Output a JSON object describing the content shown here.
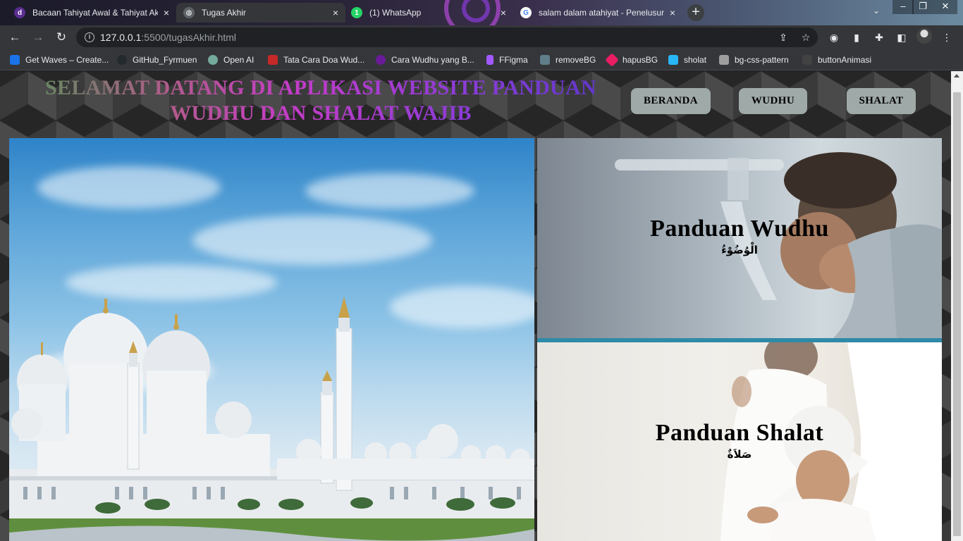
{
  "browser": {
    "tabs": [
      {
        "title": "Bacaan Tahiyat Awal & Tahiyat Ak",
        "icon": "d-site-icon",
        "active": false
      },
      {
        "title": "Tugas Akhir",
        "icon": "globe-icon",
        "active": true
      },
      {
        "title": "(1) WhatsApp",
        "icon": "whatsapp-icon",
        "active": false
      },
      {
        "title": "salam dalam atahiyat - Penelusur",
        "icon": "google-icon",
        "active": false
      }
    ],
    "close_symbol": "×",
    "new_tab_symbol": "+",
    "url_host": "127.0.0.1",
    "url_path": ":5500/tugasAkhir.html",
    "bookmarks": [
      {
        "label": "Get Waves – Create...",
        "color": "#1a73e8"
      },
      {
        "label": "GitHub_Fyrmuen",
        "color": "#24292e"
      },
      {
        "label": "Open AI",
        "color": "#74aa9c"
      },
      {
        "label": "Tata Cara Doa Wud...",
        "color": "#c62828"
      },
      {
        "label": "Cara Wudhu yang B...",
        "color": "#6a1b9a"
      },
      {
        "label": "FFigma",
        "color": "#a259ff"
      },
      {
        "label": "removeBG",
        "color": "#607d8b"
      },
      {
        "label": "hapusBG",
        "color": "#e91e63"
      },
      {
        "label": "sholat",
        "color": "#29b6f6"
      },
      {
        "label": "bg-css-pattern",
        "color": "#9e9e9e"
      },
      {
        "label": "buttonAnimasi",
        "color": "#424242"
      }
    ]
  },
  "page": {
    "title": "SELAMAT DATANG DI APLIKASI WEBSITE PANDUAN WUDHU DAN SHALAT WAJIB",
    "nav": {
      "beranda": "BERANDA",
      "wudhu": "WUDHU",
      "shalat": "SHALAT"
    },
    "cards": {
      "wudhu": {
        "title": "Panduan Wudhu",
        "subtitle": "الْوُضُوْءُ"
      },
      "shalat": {
        "title": "Panduan Shalat",
        "subtitle": "صَلاَةٌ"
      }
    }
  },
  "colors": {
    "card_separator": "#2f8aa8",
    "nav_button": "#9fa9a7"
  }
}
